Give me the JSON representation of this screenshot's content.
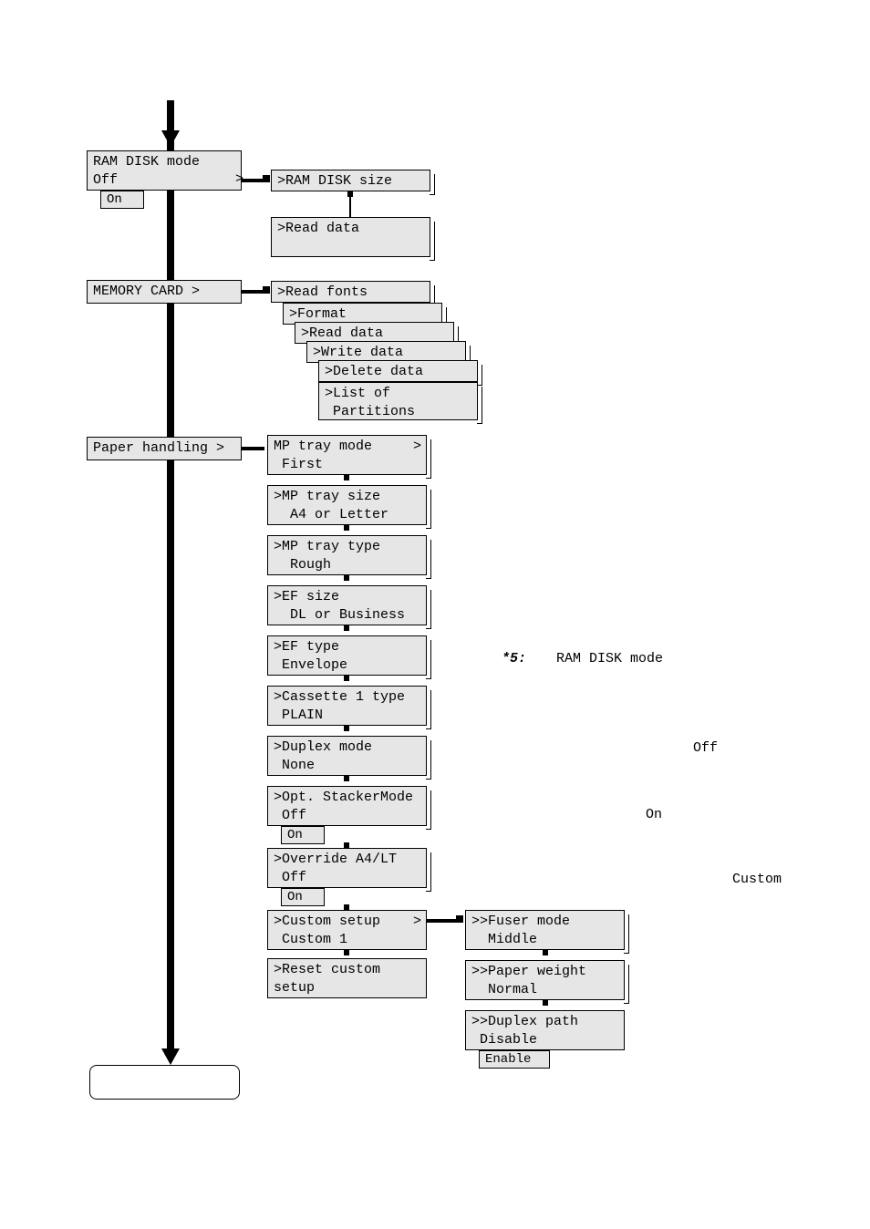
{
  "ram_disk": {
    "title": "RAM DISK mode",
    "line2": " Off",
    "on": "On",
    "sub1": ">RAM DISK size",
    "sub2": ">Read data"
  },
  "memory_card": {
    "title": "MEMORY CARD      >",
    "s1": ">Read fonts",
    "s2": ">Format",
    "s3": ">Read data",
    "s4": ">Write data",
    "s5": ">Delete data",
    "s6": ">List of\n Partitions"
  },
  "paper": {
    "title": "Paper handling   >",
    "mp_mode": "MP tray mode     >\n First",
    "mp_size": ">MP tray size\n  A4 or Letter",
    "mp_type": ">MP tray type\n  Rough",
    "ef_size": ">EF size\n  DL or Business",
    "ef_type": ">EF type\n Envelope",
    "cas": ">Cassette 1 type\n PLAIN",
    "duplex": ">Duplex mode\n None",
    "stacker": ">Opt. StackerMode\n Off",
    "stacker_on": "On",
    "override": ">Override A4/LT\n Off",
    "override_on": "On",
    "custom": ">Custom setup    >\n Custom 1",
    "reset": ">Reset custom\nsetup"
  },
  "custom_sub": {
    "fuser": ">>Fuser mode\n  Middle",
    "weight": ">>Paper weight\n  Normal",
    "dpath": ">>Duplex path\n Disable",
    "enable": "Enable"
  },
  "notes": {
    "star": "*5:",
    "ram": "RAM DISK mode",
    "off": "Off",
    "on": "On",
    "custom": "Custom"
  },
  "gt1": ">",
  "chart_data": {
    "type": "tree",
    "description": "Printer control-panel menu hierarchy",
    "nodes": [
      {
        "label": "RAM DISK mode",
        "value": "Off",
        "alt": "On",
        "children": [
          {
            "label": ">RAM DISK size"
          },
          {
            "label": ">Read data"
          }
        ]
      },
      {
        "label": "MEMORY CARD",
        "children": [
          {
            "label": ">Read fonts"
          },
          {
            "label": ">Format"
          },
          {
            "label": ">Read data"
          },
          {
            "label": ">Write data"
          },
          {
            "label": ">Delete data"
          },
          {
            "label": ">List of Partitions"
          }
        ]
      },
      {
        "label": "Paper handling",
        "children": [
          {
            "label": "MP tray mode",
            "value": "First"
          },
          {
            "label": ">MP tray size",
            "value": "A4 or Letter"
          },
          {
            "label": ">MP tray type",
            "value": "Rough"
          },
          {
            "label": ">EF size",
            "value": "DL or Business"
          },
          {
            "label": ">EF type",
            "value": "Envelope"
          },
          {
            "label": ">Cassette 1 type",
            "value": "PLAIN"
          },
          {
            "label": ">Duplex mode",
            "value": "None"
          },
          {
            "label": ">Opt. StackerMode",
            "value": "Off",
            "alt": "On"
          },
          {
            "label": ">Override A4/LT",
            "value": "Off",
            "alt": "On"
          },
          {
            "label": ">Custom setup",
            "value": "Custom 1",
            "children": [
              {
                "label": ">>Fuser mode",
                "value": "Middle"
              },
              {
                "label": ">>Paper weight",
                "value": "Normal"
              },
              {
                "label": ">>Duplex path",
                "value": "Disable",
                "alt": "Enable"
              }
            ]
          },
          {
            "label": ">Reset custom setup"
          }
        ]
      }
    ],
    "footnote": {
      "id": "*5",
      "refers_to": "RAM DISK mode",
      "values": [
        "Off",
        "On",
        "Custom"
      ]
    }
  }
}
